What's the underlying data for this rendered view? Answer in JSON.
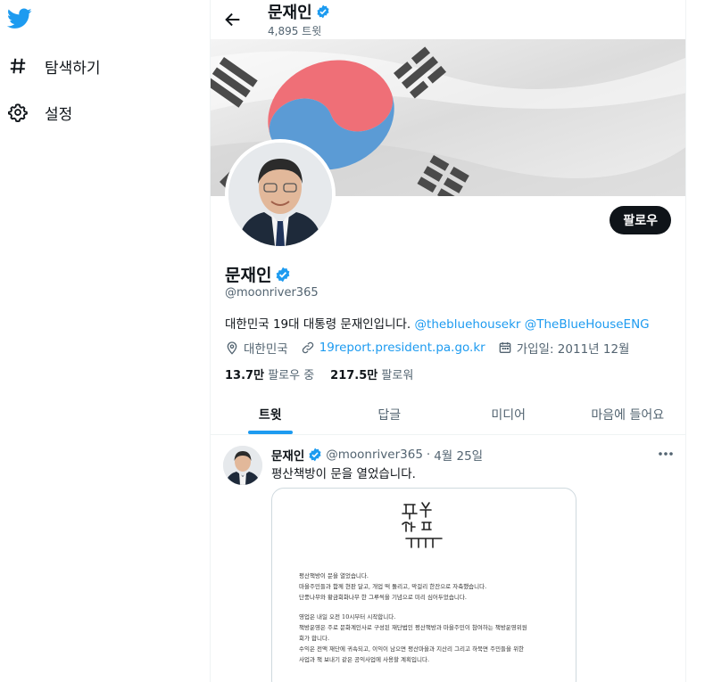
{
  "nav": {
    "items": [
      {
        "label": "탐색하기",
        "icon": "hashtag-icon"
      },
      {
        "label": "설정",
        "icon": "gear-icon"
      }
    ]
  },
  "header": {
    "name": "문재인",
    "tweet_count": "4,895 트윗"
  },
  "profile": {
    "name": "문재인",
    "handle": "@moonriver365",
    "bio_text": "대한민국 19대 대통령 문재인입니다.",
    "bio_mention_1": "@thebluehousekr",
    "bio_mention_2": "@TheBlueHouseENG",
    "location": "대한민국",
    "website": "19report.president.pa.go.kr",
    "joined": "가입일: 2011년 12월",
    "following_count": "13.7만",
    "following_label": "팔로우 중",
    "followers_count": "217.5만",
    "followers_label": "팔로워",
    "follow_button": "팔로우"
  },
  "tabs": [
    {
      "label": "트윗",
      "active": true
    },
    {
      "label": "답글",
      "active": false
    },
    {
      "label": "미디어",
      "active": false
    },
    {
      "label": "마음에 들어요",
      "active": false
    }
  ],
  "tweet": {
    "name": "문재인",
    "handle": "@moonriver365",
    "separator": "·",
    "date": "4월 25일",
    "text": "평산책방이 문을 열었습니다.",
    "card_lines": [
      "평산책방이 문을 열었습니다.",
      "마을주민들과 함께 현판 달고, 개업 떡 돌리고, 막걸리 한잔으로 자축했습니다.",
      "단풍나무와 황금회화나무 한 그루씩을 기념으로 미리 심어두었습니다.",
      "",
      "영업은 내일 오전 10시부터 시작합니다.",
      "책방운영은 주로 문화계인사로 구성된 재단법인 평산책방과 마을주민이 참여하는 책방운영위원",
      "회가 합니다.",
      "수익은 전액 재단에 귀속되고, 이익이 남으면 평산마을과 지산리 그리고 하북면 주민들을 위한",
      "사업과 책 보내기 같은 공익사업에 사용할 계획입니다."
    ]
  },
  "colors": {
    "accent": "#1d9bf0",
    "text": "#0f1419",
    "muted": "#536471",
    "button_dark": "#0f1419"
  }
}
